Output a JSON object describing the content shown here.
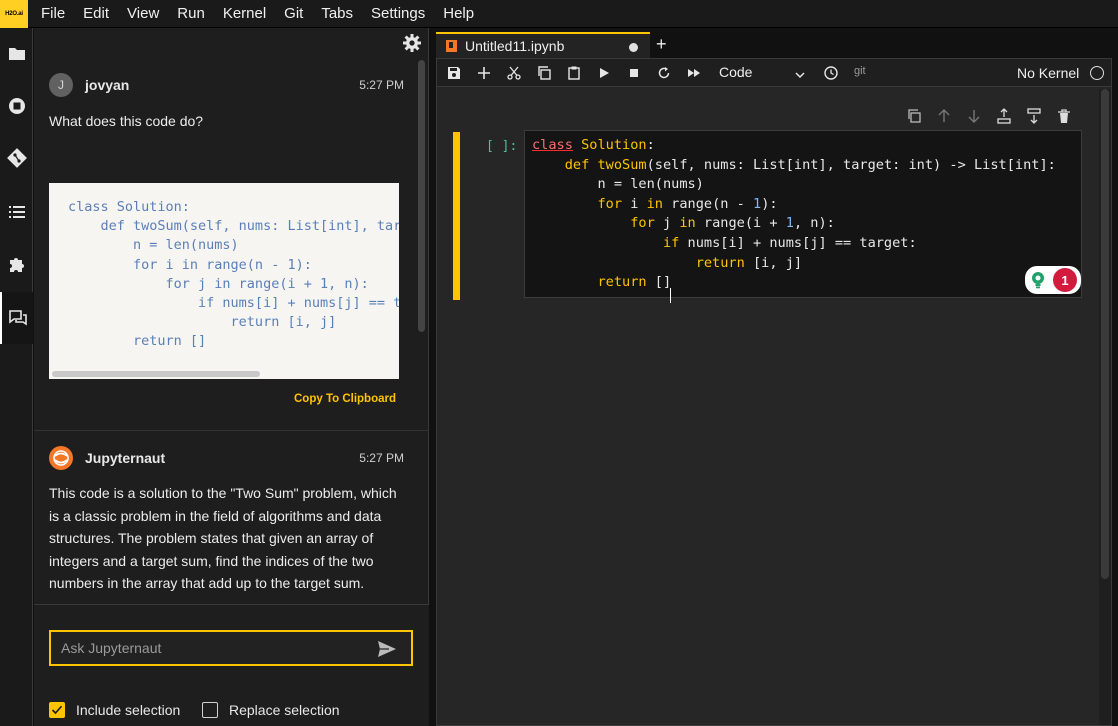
{
  "logo": {
    "text": "H2O.ai"
  },
  "menubar": {
    "items": [
      "File",
      "Edit",
      "View",
      "Run",
      "Kernel",
      "Git",
      "Tabs",
      "Settings",
      "Help"
    ]
  },
  "activity_bar": {
    "icons": [
      "folder-icon",
      "running-icon",
      "git-icon",
      "toc-icon",
      "extension-icon",
      "chat-icon"
    ],
    "active": "chat-icon"
  },
  "chat": {
    "messages": [
      {
        "avatar": "J",
        "user": "jovyan",
        "time": "5:27 PM",
        "text": "What does this code do?",
        "code": "class Solution:\n    def twoSum(self, nums: List[int], target: int) -> List[int]:\n        n = len(nums)\n        for i in range(n - 1):\n            for j in range(i + 1, n):\n                if nums[i] + nums[j] == target:\n                    return [i, j]\n        return []",
        "copy_label": "Copy To Clipboard"
      },
      {
        "user": "Jupyternaut",
        "time": "5:27 PM",
        "text": "This code is a solution to the \"Two Sum\" problem, which is a classic problem in the field of algorithms and data structures. The problem states that given an array of integers and a target sum, find the indices of the two numbers in the array that add up to the target sum."
      }
    ],
    "input": {
      "placeholder": "Ask Jupyternaut",
      "value": ""
    },
    "include_selection": {
      "label": "Include selection",
      "checked": true
    },
    "replace_selection": {
      "label": "Replace selection",
      "checked": false
    }
  },
  "notebook": {
    "tab_title": "Untitled11.ipynb",
    "toolbar": {
      "cell_type": "Code",
      "git_label": "git",
      "kernel": "No Kernel"
    },
    "cell": {
      "prompt": "[ ]:",
      "badge_count": "1"
    }
  },
  "colors": {
    "accent": "#ffc400",
    "keyword": "#ffc400",
    "error_underline": "#ff2b2b",
    "prompt": "#4dbf9b",
    "badge": "#d21b3c"
  }
}
